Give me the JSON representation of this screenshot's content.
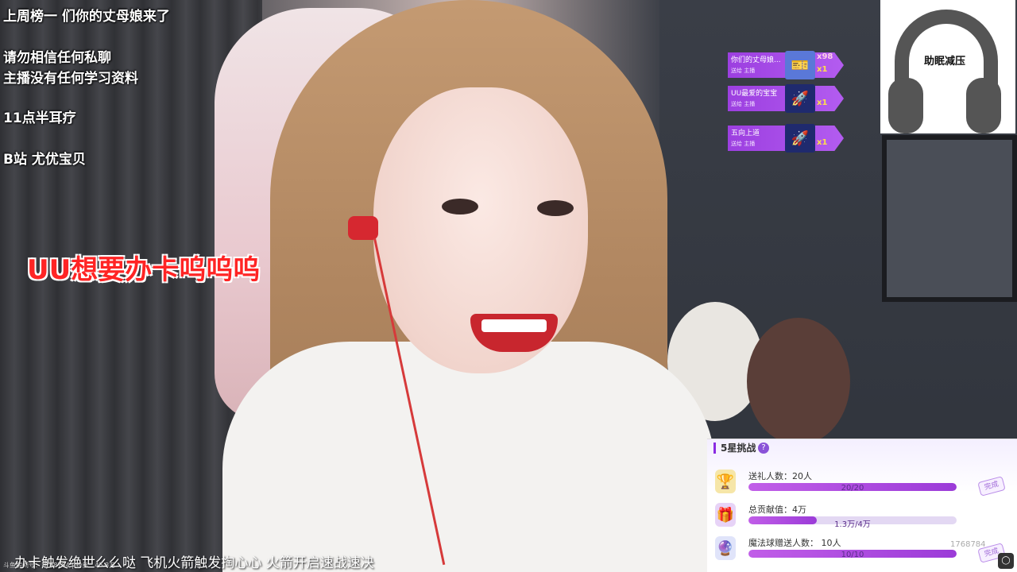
{
  "overlay": {
    "line1": "上周榜一 们你的丈母娘来了",
    "line2": "请勿相信任何私聊",
    "line3": "主播没有任何学习资料",
    "line4": "11点半耳疗",
    "line5": "B站 尤优宝贝",
    "red_caption": "UU想要办卡呜呜呜"
  },
  "gifts": [
    {
      "name": "你们的丈母娘...",
      "sub": "送给  主播",
      "count_top": "x98",
      "count": "x1",
      "icon": "ticket-icon"
    },
    {
      "name": "UU最爱的宝宝",
      "sub": "送给  主播",
      "count": "x1",
      "icon": "rocket-icon"
    },
    {
      "name": "五向上道",
      "sub": "送给  主播",
      "count": "x1",
      "icon": "rocket-icon"
    }
  ],
  "logo": {
    "label": "助眠减压"
  },
  "challenge": {
    "title": "5星挑战",
    "help": "?",
    "tasks": [
      {
        "label": "送礼人数：20人",
        "value": "20/20",
        "progress": 1.0,
        "icon": "trophy-icon",
        "done": "完成"
      },
      {
        "label": "总贡献值：4万",
        "value": "1.3万/4万",
        "progress": 0.33,
        "icon": "gift-box-icon",
        "done": ""
      },
      {
        "label": "魔法球赠送人数： 10人",
        "value": "10/10",
        "progress": 1.0,
        "icon": "magic-ball-icon",
        "done": "完成"
      }
    ]
  },
  "room_id": "1768784",
  "subtitle": "办卡触发绝世么么哒 飞机火箭触发掏心心 火箭开启速战速决",
  "watermark": "斗鱼房间号：1768784 | 粉丝：45.3万",
  "colors": {
    "accent": "#9c3fe0",
    "red": "#ff2424"
  }
}
